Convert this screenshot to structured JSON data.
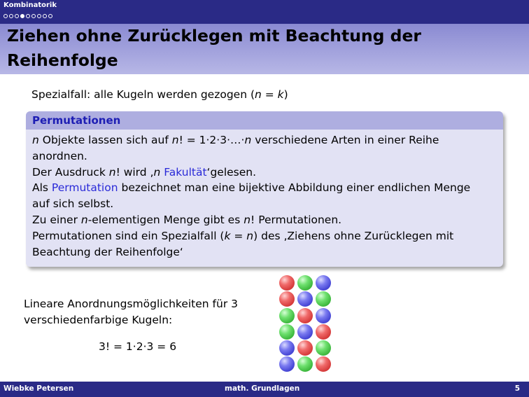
{
  "header": {
    "section": "Kombinatorik",
    "nav_dots": [
      false,
      false,
      false,
      true,
      false,
      false,
      false,
      false,
      false
    ]
  },
  "title": {
    "line1": "Ziehen ohne Zurücklegen mit Beachtung der",
    "line2": "Reihenfolge"
  },
  "intro": {
    "text": "Spezialfall:  alle Kugeln werden gezogen (",
    "math": "n = k",
    "close": ")"
  },
  "block": {
    "title": "Permutationen",
    "l1_a": "n",
    "l1_b": " Objekte lassen sich auf ",
    "l1_c": "n",
    "l1_d": "! = 1·2·3·…·",
    "l1_e": "n",
    "l1_f": " verschiedene Arten in einer Reihe",
    "l2": "anordnen.",
    "l3_a": "Der Ausdruck ",
    "l3_b": "n",
    "l3_c": "! wird ‚",
    "l3_d": "n",
    "l3_e": " ",
    "l3_link": "Fakultät",
    "l3_f": "‘gelesen.",
    "l4_a": "Als ",
    "l4_link": "Permutation",
    "l4_b": " bezeichnet man eine bijektive Abbildung einer endlichen Menge",
    "l5": "auf sich selbst.",
    "l6_a": "Zu einer ",
    "l6_b": "n",
    "l6_c": "-elementigen Menge gibt es ",
    "l6_d": "n",
    "l6_e": "! Permutationen.",
    "l7_a": "Permutationen sind ein Spezialfall (",
    "l7_b": "k = n",
    "l7_c": ") des ‚Ziehens ohne Zurücklegen mit",
    "l8": "Beachtung der Reihenfolge‘"
  },
  "example": {
    "line1": "Lineare Anordnungsmöglichkeiten für 3",
    "line2": "verschiedenfarbige Kugeln:",
    "formula": "3! = 1·2·3 = 6"
  },
  "balls": [
    [
      "red",
      "green",
      "blue"
    ],
    [
      "red",
      "blue",
      "green"
    ],
    [
      "green",
      "red",
      "blue"
    ],
    [
      "green",
      "blue",
      "red"
    ],
    [
      "blue",
      "red",
      "green"
    ],
    [
      "blue",
      "green",
      "red"
    ]
  ],
  "colors": {
    "header_bg": "#2a2a86",
    "block_title": "#1e1eb4",
    "link": "#2a2ad8"
  },
  "footer": {
    "author": "Wiebke Petersen",
    "course": "math.  Grundlagen",
    "page": "5"
  }
}
